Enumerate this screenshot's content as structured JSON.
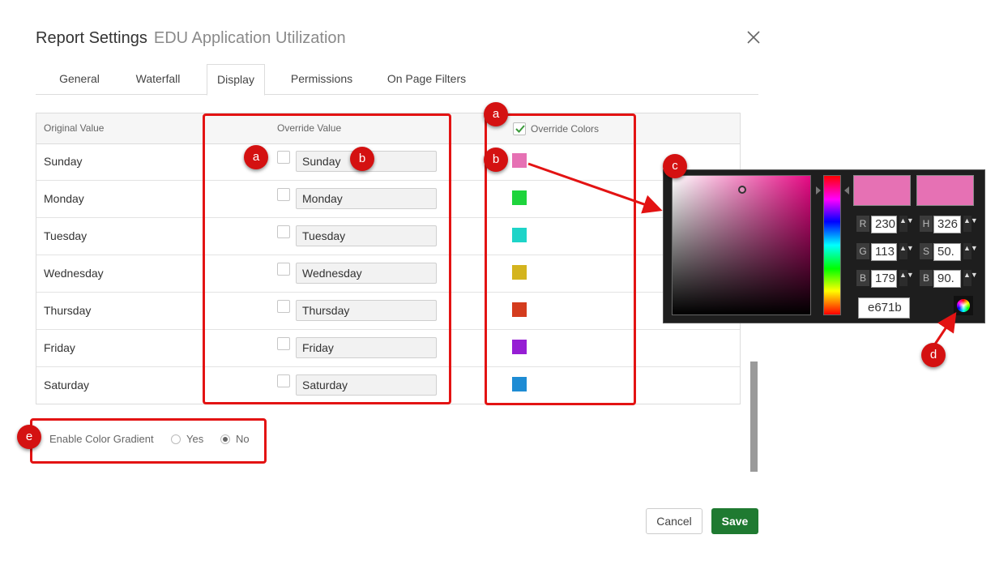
{
  "header": {
    "title": "Report Settings",
    "subtitle": "EDU Application Utilization",
    "close_icon": "close-icon"
  },
  "tabs": [
    {
      "label": "General",
      "active": false
    },
    {
      "label": "Waterfall",
      "active": false
    },
    {
      "label": "Display",
      "active": true
    },
    {
      "label": "Permissions",
      "active": false
    },
    {
      "label": "On Page Filters",
      "active": false
    }
  ],
  "table": {
    "columns": {
      "original": "Original Value",
      "override": "Override Value",
      "colors": "Override Colors"
    },
    "override_colors_checked": true,
    "rows": [
      {
        "original": "Sunday",
        "override": "Sunday",
        "color": "#e671b4"
      },
      {
        "original": "Monday",
        "override": "Monday",
        "color": "#1ed43c"
      },
      {
        "original": "Tuesday",
        "override": "Tuesday",
        "color": "#1ed4c8"
      },
      {
        "original": "Wednesday",
        "override": "Wednesday",
        "color": "#d4b41e"
      },
      {
        "original": "Thursday",
        "override": "Thursday",
        "color": "#d43c1e"
      },
      {
        "original": "Friday",
        "override": "Friday",
        "color": "#961ed4"
      },
      {
        "original": "Saturday",
        "override": "Saturday",
        "color": "#1e8cd4"
      }
    ]
  },
  "gradient": {
    "label": "Enable Color Gradient",
    "yes": "Yes",
    "no": "No",
    "selected": "No"
  },
  "buttons": {
    "cancel": "Cancel",
    "save": "Save"
  },
  "picker": {
    "current_color": "#e671b4",
    "new_color": "#e671b4",
    "r_label": "R",
    "r_value": "230",
    "g_label": "G",
    "g_value": "113",
    "b_label": "B",
    "b_value": "179",
    "h_label": "H",
    "h_value": "326",
    "s_label": "S",
    "s_value": "50.",
    "v_label": "B",
    "v_value": "90.",
    "hex": "e671b",
    "spin_glyph": "▲▼"
  },
  "annotations": {
    "a1": "a",
    "a2": "a",
    "b1": "b",
    "b2": "b",
    "b3": "b",
    "c": "c",
    "d": "d",
    "e": "e",
    "highlight_color": "#e31313"
  }
}
